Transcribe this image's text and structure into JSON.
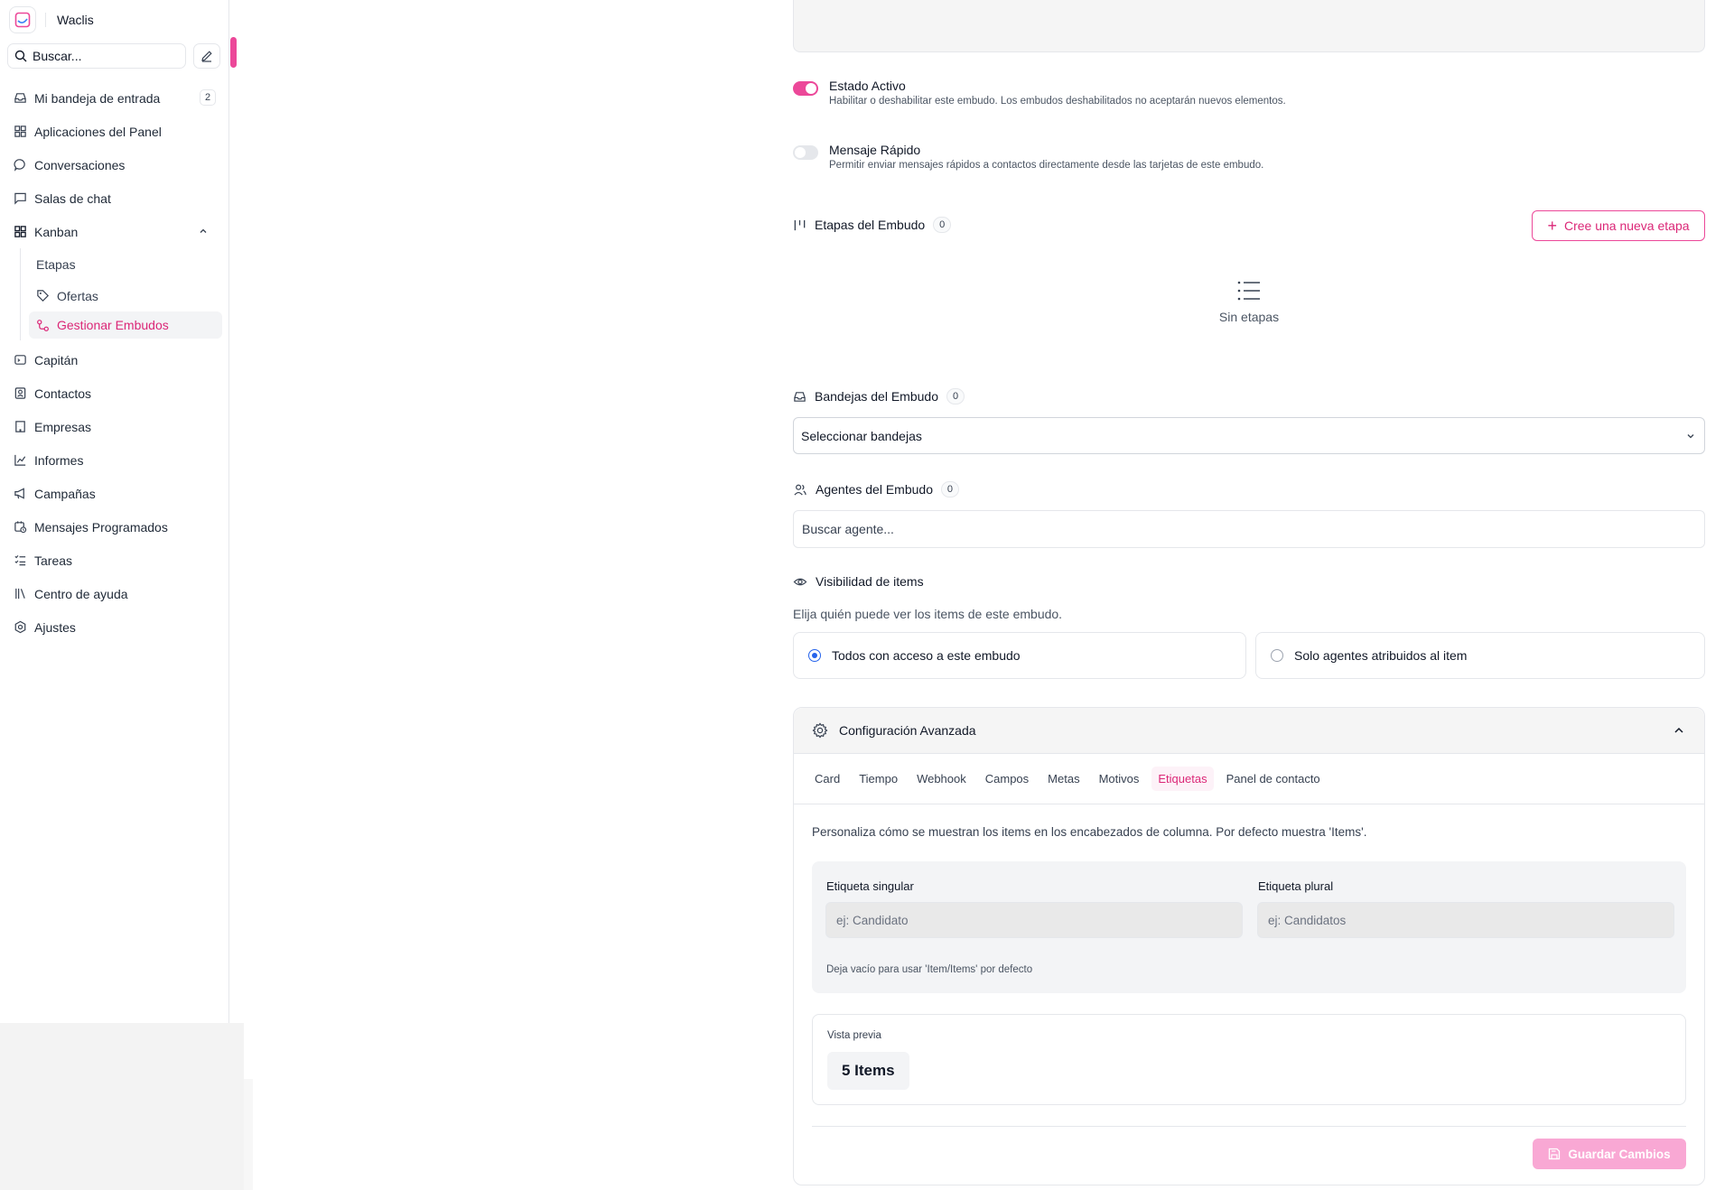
{
  "app": {
    "name": "Waclis"
  },
  "sidebar": {
    "search_placeholder": "Buscar...",
    "items": [
      {
        "label": "Mi bandeja de entrada",
        "icon": "inbox-icon",
        "badge": "2"
      },
      {
        "label": "Aplicaciones del Panel",
        "icon": "apps-grid-icon"
      },
      {
        "label": "Conversaciones",
        "icon": "chat-bubble-icon"
      },
      {
        "label": "Salas de chat",
        "icon": "chat-square-icon"
      },
      {
        "label": "Kanban",
        "icon": "kanban-grid-icon",
        "expanded": true
      }
    ],
    "kanban_sub": [
      {
        "label": "Etapas"
      },
      {
        "label": "Ofertas",
        "icon": "tag-icon"
      },
      {
        "label": "Gestionar Embudos",
        "icon": "funnel-icon",
        "active": true
      }
    ],
    "items_after": [
      {
        "label": "Capitán",
        "icon": "captain-icon"
      },
      {
        "label": "Contactos",
        "icon": "contacts-icon"
      },
      {
        "label": "Empresas",
        "icon": "building-icon"
      },
      {
        "label": "Informes",
        "icon": "chart-line-icon"
      },
      {
        "label": "Campañas",
        "icon": "megaphone-icon"
      },
      {
        "label": "Mensajes Programados",
        "icon": "calendar-clock-icon"
      },
      {
        "label": "Tareas",
        "icon": "tasks-icon"
      },
      {
        "label": "Centro de ayuda",
        "icon": "library-icon"
      },
      {
        "label": "Ajustes",
        "icon": "settings-icon"
      }
    ]
  },
  "main": {
    "active_state": {
      "title": "Estado Activo",
      "desc": "Habilitar o deshabilitar este embudo. Los embudos deshabilitados no aceptarán nuevos elementos.",
      "on": true
    },
    "quick_message": {
      "title": "Mensaje Rápido",
      "desc": "Permitir enviar mensajes rápidos a contactos directamente desde las tarjetas de este embudo.",
      "on": false
    },
    "stages": {
      "title": "Etapas del Embudo",
      "count": "0",
      "new_button": "Cree una nueva etapa",
      "empty": "Sin etapas"
    },
    "inboxes": {
      "title": "Bandejas del Embudo",
      "count": "0",
      "select_value": "Seleccionar bandejas"
    },
    "agents": {
      "title": "Agentes del Embudo",
      "count": "0",
      "placeholder": "Buscar agente..."
    },
    "visibility": {
      "title": "Visibilidad de items",
      "desc": "Elija quién puede ver los items de este embudo.",
      "options": [
        {
          "label": "Todos con acceso a este embudo",
          "checked": true
        },
        {
          "label": "Solo agentes atribuidos al item",
          "checked": false
        }
      ]
    },
    "advanced": {
      "title": "Configuración Avanzada",
      "tabs": [
        "Card",
        "Tiempo",
        "Webhook",
        "Campos",
        "Metas",
        "Motivos",
        "Etiquetas",
        "Panel de contacto"
      ],
      "active_tab": "Etiquetas",
      "desc": "Personaliza cómo se muestran los items en los encabezados de columna. Por defecto muestra 'Items'.",
      "singular_label": "Etiqueta singular",
      "singular_placeholder": "ej: Candidato",
      "plural_label": "Etiqueta plural",
      "plural_placeholder": "ej: Candidatos",
      "hint": "Deja vacío para usar 'Item/Items' por defecto",
      "preview_label": "Vista previa",
      "preview_value": "5 Items",
      "save_button": "Guardar Cambios"
    }
  },
  "colors": {
    "accent": "#ec4899",
    "accent_text": "#db2777",
    "radio": "#2563eb",
    "save_disabled": "#f9a8d4"
  }
}
